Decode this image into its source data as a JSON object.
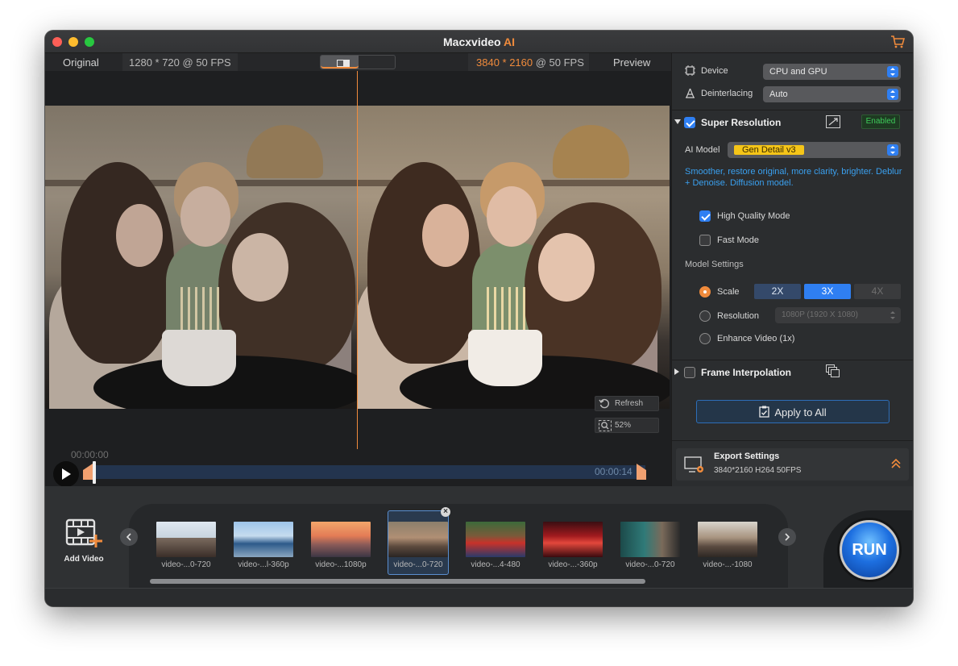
{
  "window": {
    "title": "Macxvideo",
    "title_accent": "AI"
  },
  "preview": {
    "left_label": "Original",
    "left_resolution": "1280 * 720 @ 50 FPS",
    "right_resolution_hi": "3840 * 2160",
    "right_resolution_rest": " @ 50 FPS",
    "right_label": "Preview",
    "refresh_label": "Refresh",
    "zoom_label": "52%"
  },
  "timeline": {
    "start": "00:00:00",
    "end": "00:00:14"
  },
  "panel": {
    "device_label": "Device",
    "device_value": "CPU and GPU",
    "deinterlacing_label": "Deinterlacing",
    "deinterlacing_value": "Auto",
    "super_resolution": {
      "title": "Super Resolution",
      "badge": "Enabled",
      "ai_model_label": "AI Model",
      "ai_model_value": "Gen Detail v3",
      "description": "Smoother, restore original, more clarity, brighter. Deblur + Denoise. Diffusion model.",
      "high_quality": "High Quality Mode",
      "fast_mode": "Fast Mode",
      "model_settings": "Model Settings",
      "scale_label": "Scale",
      "scale_options": [
        "2X",
        "3X",
        "4X"
      ],
      "resolution_label": "Resolution",
      "resolution_value": "1080P (1920 X 1080)",
      "enhance_label": "Enhance Video (1x)"
    },
    "frame_interpolation": {
      "title": "Frame Interpolation"
    },
    "apply_all": "Apply to All",
    "export": {
      "title": "Export Settings",
      "subtitle": "3840*2160 H264 50FPS"
    }
  },
  "bottom": {
    "add_video": "Add Video",
    "run": "RUN",
    "thumbnails": [
      {
        "name": "video-...0-720"
      },
      {
        "name": "video-...l-360p"
      },
      {
        "name": "video-...1080p"
      },
      {
        "name": "video-...0-720"
      },
      {
        "name": "video-...4-480"
      },
      {
        "name": "video-...-360p"
      },
      {
        "name": "video-...0-720"
      },
      {
        "name": "video-...-1080"
      }
    ]
  }
}
